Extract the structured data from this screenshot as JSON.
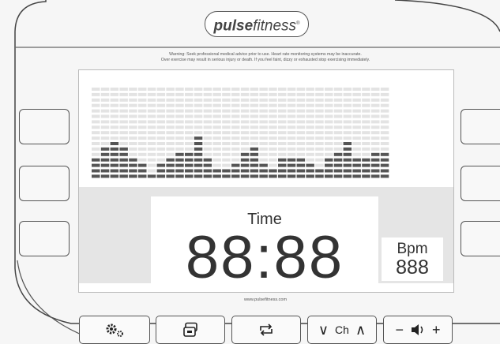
{
  "brand": {
    "name_bold": "pulse",
    "name_rest": "fitness",
    "mark": "®"
  },
  "warning": {
    "line1": "Warning: Seek professional medical advice prior to use. Heart rate monitoring systems may be inaccurate.",
    "line2": "Over exercise may result in serious injury or death.  If you feel faint, dizzy or exhausted stop exercising immediately."
  },
  "display": {
    "time_label": "Time",
    "time_value": "88:88",
    "bpm_label": "Bpm",
    "bpm_value": "888"
  },
  "equalizer": {
    "rows": 17,
    "levels": [
      4,
      6,
      7,
      6,
      4,
      3,
      1,
      3,
      4,
      5,
      5,
      8,
      4,
      2,
      2,
      3,
      5,
      6,
      3,
      2,
      4,
      4,
      4,
      3,
      2,
      4,
      5,
      7,
      4,
      4,
      5,
      5
    ]
  },
  "footer": {
    "url": "www.pulsefitness.com"
  },
  "bottom_buttons": {
    "settings_icon": "gears-icon",
    "display_icon": "window-icon",
    "repeat_icon": "repeat-icon",
    "channel_label": "Ch",
    "channel_down": "∨",
    "channel_up": "∧",
    "volume_down": "−",
    "volume_icon": "speaker-icon",
    "volume_up": "+"
  },
  "colors": {
    "lit_segment": "#555555",
    "unlit_segment": "#e3e3e3",
    "outline": "#555555"
  }
}
